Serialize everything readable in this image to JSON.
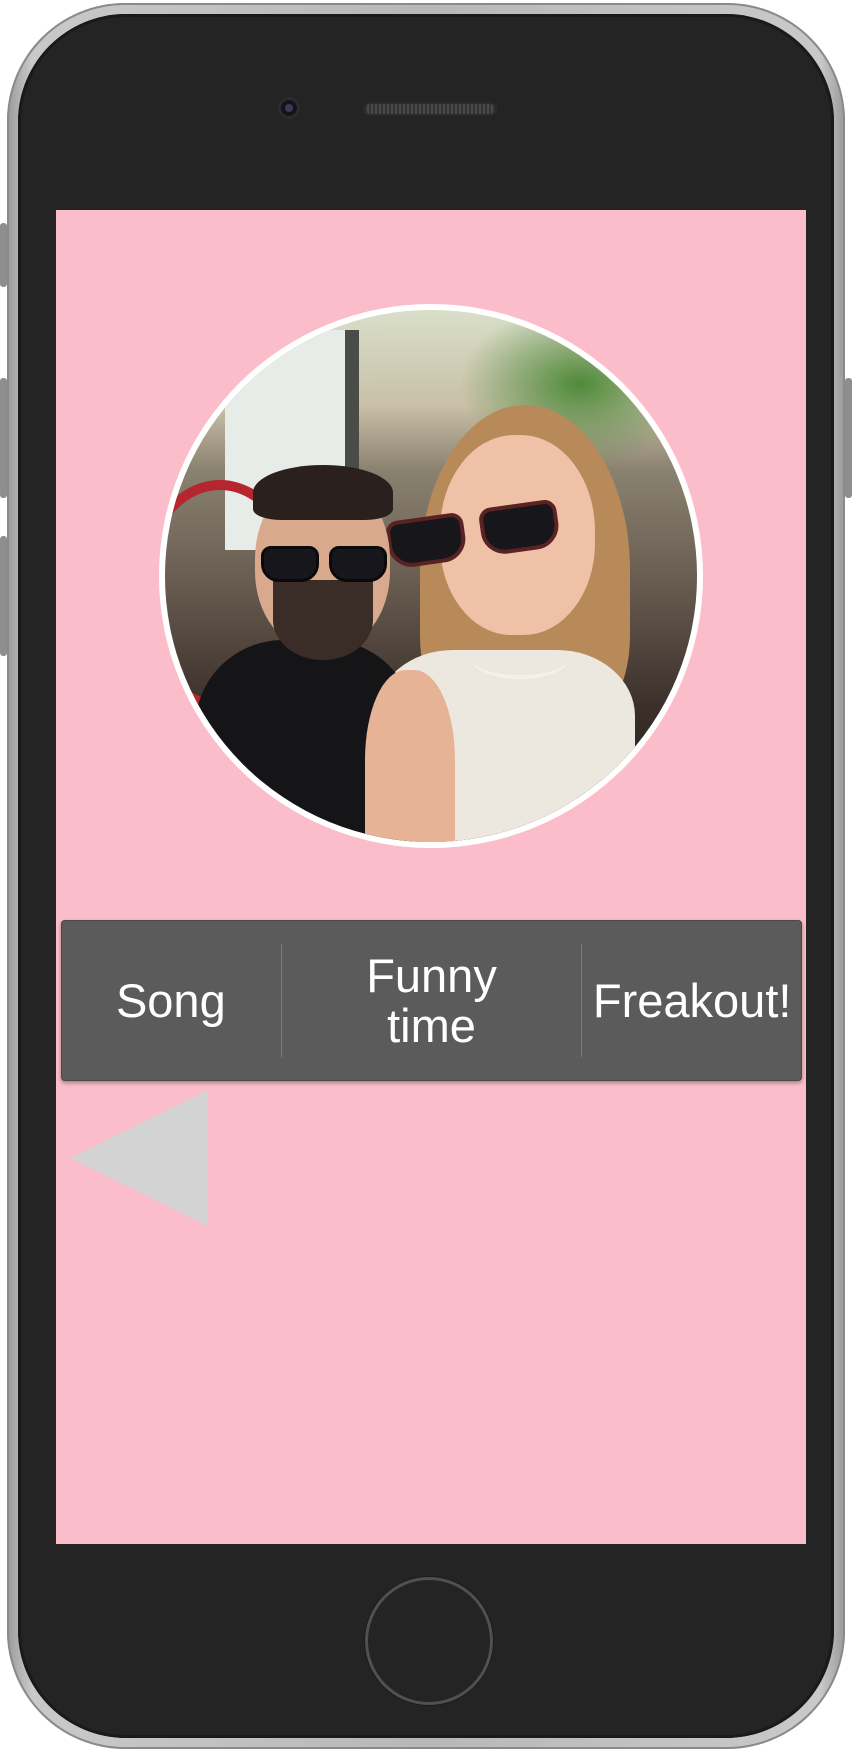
{
  "menu": {
    "items": [
      {
        "label": "Song"
      },
      {
        "label": "Funny time"
      },
      {
        "label": "Freakout!"
      }
    ]
  },
  "profile": {
    "photo": "couple-selfie-photo"
  },
  "icons": {
    "back": "left-triangle-icon"
  },
  "colors": {
    "screen_background": "#fcbdca",
    "menu_background": "#5b5b5b",
    "menu_text": "#ffffff",
    "back_arrow": "#d3d3d3"
  }
}
